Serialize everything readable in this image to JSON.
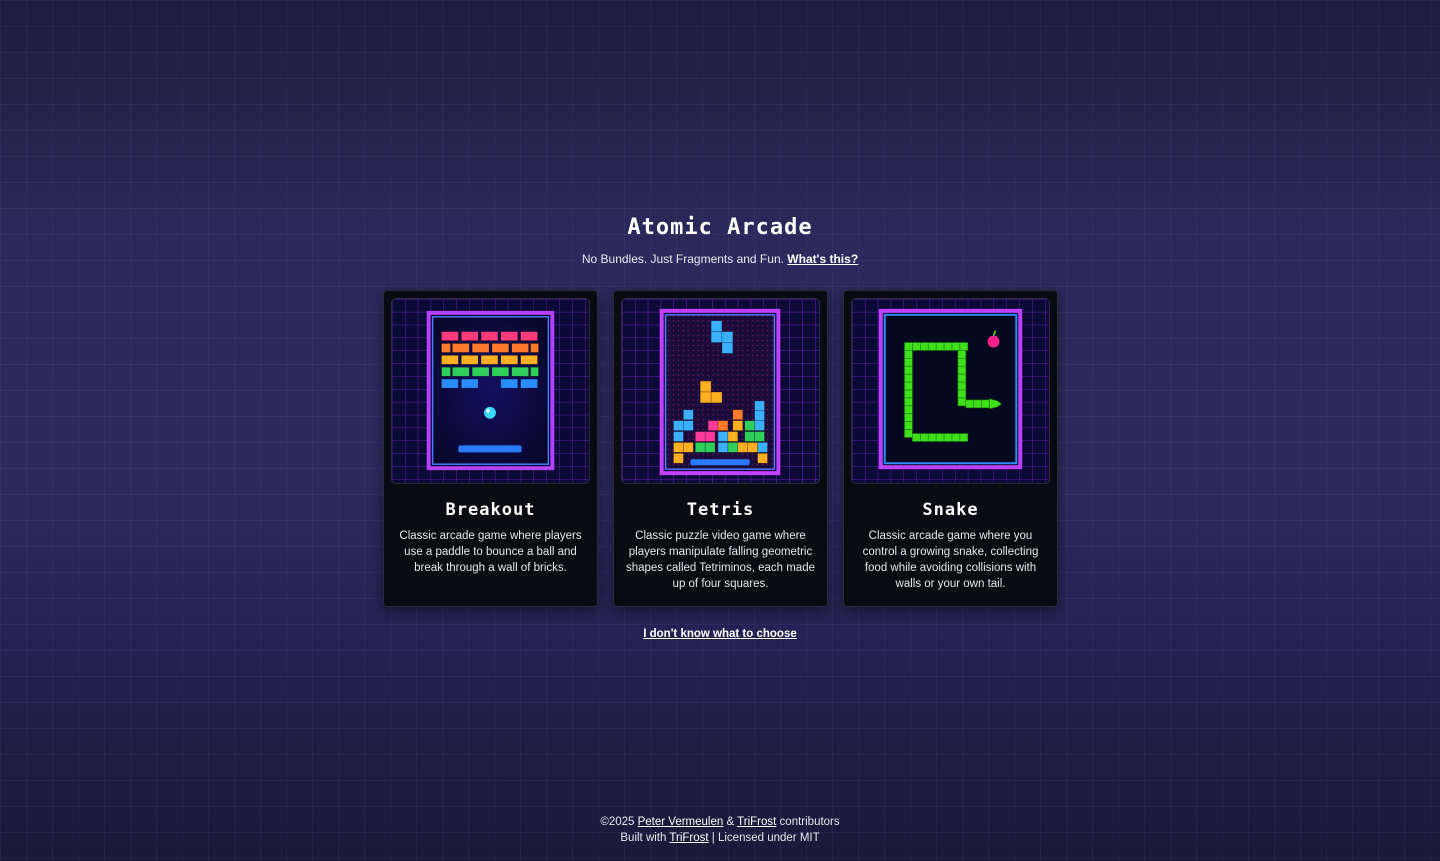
{
  "header": {
    "title": "Atomic Arcade",
    "tagline": "No Bundles. Just Fragments and Fun.",
    "whats_this_link": "What's this?"
  },
  "games": [
    {
      "id": "breakout",
      "title": "Breakout",
      "description": "Classic arcade game where players use a paddle to bounce a ball and break through a wall of bricks.",
      "thumbnail_icon": "breakout-thumbnail-icon"
    },
    {
      "id": "tetris",
      "title": "Tetris",
      "description": "Classic puzzle video game where players manipulate falling geometric shapes called Tetriminos, each made up of four squares.",
      "thumbnail_icon": "tetris-thumbnail-icon"
    },
    {
      "id": "snake",
      "title": "Snake",
      "description": "Classic arcade game where you control a growing snake, collecting food while avoiding collisions with walls or your own tail.",
      "thumbnail_icon": "snake-thumbnail-icon"
    }
  ],
  "random_choice_link": "I don't know what to choose",
  "footer": {
    "copyright": "©2025",
    "author_link": "Peter Vermeulen",
    "ampersand": "&",
    "project_link": "TriFrost",
    "contributors": "contributors",
    "built_with": "Built with",
    "built_with_link": "TriFrost",
    "license": "| Licensed under MIT"
  },
  "colors": {
    "background_top": "#1e1d3f",
    "background_mid": "#2c2b5e",
    "card_background": "#0a0a12",
    "neon_blue": "#3d6bff",
    "neon_magenta": "#d03cff",
    "snake_green": "#3fe01a"
  }
}
